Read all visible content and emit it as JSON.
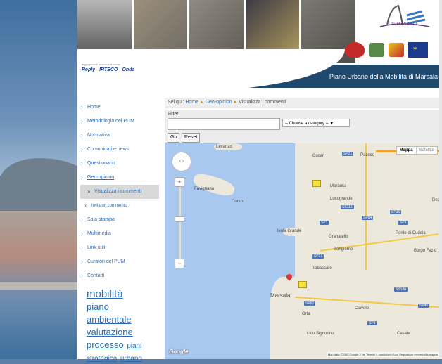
{
  "header": {
    "title": "Piano Urbano della Mobilità di Marsala",
    "sponsor_caption": "Raggruppamento temporaneo di imprese",
    "sponsors": [
      "Reply",
      "IRTECO",
      "Onda"
    ],
    "logo_text": "PUMARSALA"
  },
  "sidebar": {
    "items": [
      {
        "label": "Home"
      },
      {
        "label": "Metodologia del PUM"
      },
      {
        "label": "Normativa"
      },
      {
        "label": "Comunicati e news"
      },
      {
        "label": "Questionario"
      },
      {
        "label": "Geo-opinion"
      },
      {
        "label": "Visualizza i commenti"
      },
      {
        "label": "Invia un commento"
      },
      {
        "label": "Sala stampa"
      },
      {
        "label": "Multimedia"
      },
      {
        "label": "Link utili"
      },
      {
        "label": "Curatori del PUM"
      },
      {
        "label": "Contatti"
      }
    ],
    "tags": [
      "mobilità",
      "piano",
      "ambientale",
      "valutazione",
      "processo",
      "piani",
      "strategica",
      "urbano"
    ]
  },
  "breadcrumb": {
    "prefix": "Sei qui:",
    "home": "Home",
    "section": "Geo-opinion",
    "current": "Visualizza i commenti",
    "separator": "▸"
  },
  "filter": {
    "label": "Filter:",
    "input_value": "",
    "select_value": "-- Choose a category --",
    "go_label": "Go",
    "reset_label": "Reset"
  },
  "map": {
    "type_map": "Mappa",
    "type_satellite": "Satellite",
    "pan_label": "‹ ›",
    "zoom_in": "+",
    "zoom_out": "−",
    "logo": "Google",
    "attribution": "Map data ©2015 Google   2 km   Termini e condizioni d'uso   Segnala un errore nella mappa",
    "places": [
      "Levanzo",
      "Cucari",
      "Paceco",
      "Favignana",
      "Corso",
      "Marausa",
      "Locogrande",
      "Isola Grande",
      "Granatello",
      "Borgo Fazio",
      "Ponte di Cuddia",
      "Bongiorno",
      "Tabaccaro",
      "Marsala",
      "Ciavolo",
      "Orta",
      "Casale",
      "Lido Signorino",
      "Deg"
    ],
    "road_labels": [
      "SP21",
      "SS115",
      "SP35",
      "SP84",
      "SP1",
      "SP21",
      "SP8",
      "SS188",
      "SP62",
      "SP40",
      "SP3"
    ]
  }
}
